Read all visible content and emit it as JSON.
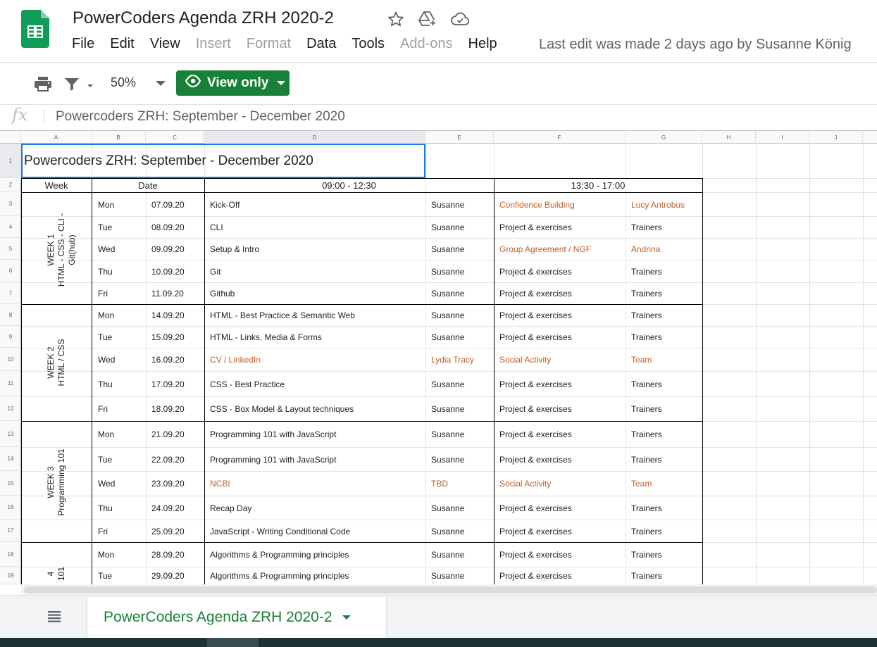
{
  "header": {
    "doc_title": "PowerCoders Agenda ZRH 2020-2",
    "last_edit": "Last edit was made 2 days ago by Susanne König",
    "menu": [
      "File",
      "Edit",
      "View",
      "Insert",
      "Format",
      "Data",
      "Tools",
      "Add-ons",
      "Help"
    ],
    "menu_disabled": [
      false,
      false,
      false,
      true,
      true,
      false,
      false,
      true,
      false
    ]
  },
  "toolbar": {
    "zoom": "50%",
    "view_only_label": "View only"
  },
  "formula_bar": {
    "fx": "fx",
    "content": "Powercoders ZRH: September - December 2020"
  },
  "grid": {
    "columns": [
      "A",
      "B",
      "C",
      "D",
      "E",
      "F",
      "G",
      "H",
      "I",
      "J"
    ],
    "rows": [
      "1",
      "2",
      "3",
      "4",
      "5",
      "6",
      "7",
      "8",
      "9",
      "10",
      "11",
      "12",
      "13",
      "14",
      "15",
      "16",
      "17",
      "18",
      "19"
    ],
    "title": "Powercoders ZRH: September - December 2020",
    "header_week": "Week",
    "header_date": "Date",
    "header_morning": "09:00 - 12:30",
    "header_afternoon": "13:30 - 17:00",
    "weeks": [
      {
        "label": "WEEK 1\nHTML - CSS - CLI -\nGit(hub)"
      },
      {
        "label": "WEEK 2\nHTML / CSS"
      },
      {
        "label": "WEEK 3\nProgramming 101"
      },
      {
        "label": "4\n101"
      }
    ],
    "days": [
      {
        "day": "Mon",
        "date": "07.09.20",
        "topic": "Kick-Off",
        "trainer": "Susanne",
        "afternoon": "Confidence Building",
        "pm_trainer": "Lucy Antrobus",
        "am_hl": false,
        "pm_hl": true
      },
      {
        "day": "Tue",
        "date": "08.09.20",
        "topic": "CLI",
        "trainer": "Susanne",
        "afternoon": "Project & exercises",
        "pm_trainer": "Trainers",
        "am_hl": false,
        "pm_hl": false
      },
      {
        "day": "Wed",
        "date": "09.09.20",
        "topic": "Setup & Intro",
        "trainer": "Susanne",
        "afternoon": "Group Agreement / NGF",
        "pm_trainer": "Andrina",
        "am_hl": false,
        "pm_hl": true
      },
      {
        "day": "Thu",
        "date": "10.09.20",
        "topic": "Git",
        "trainer": "Susanne",
        "afternoon": "Project & exercises",
        "pm_trainer": "Trainers",
        "am_hl": false,
        "pm_hl": false
      },
      {
        "day": "Fri",
        "date": "11.09.20",
        "topic": "Github",
        "trainer": "Susanne",
        "afternoon": "Project & exercises",
        "pm_trainer": "Trainers",
        "am_hl": false,
        "pm_hl": false
      },
      {
        "day": "Mon",
        "date": "14.09.20",
        "topic": "HTML - Best Practice & Semantic Web",
        "trainer": "Susanne",
        "afternoon": "Project & exercises",
        "pm_trainer": "Trainers",
        "am_hl": false,
        "pm_hl": false
      },
      {
        "day": "Tue",
        "date": "15.09.20",
        "topic": "HTML - Links, Media & Forms",
        "trainer": "Susanne",
        "afternoon": "Project & exercises",
        "pm_trainer": "Trainers",
        "am_hl": false,
        "pm_hl": false
      },
      {
        "day": "Wed",
        "date": "16.09.20",
        "topic": "CV / LinkedIn",
        "trainer": "Lydia Tracy",
        "afternoon": "Social Activity",
        "pm_trainer": "Team",
        "am_hl": true,
        "pm_hl": true
      },
      {
        "day": "Thu",
        "date": "17.09.20",
        "topic": "CSS - Best Practice",
        "trainer": "Susanne",
        "afternoon": "Project & exercises",
        "pm_trainer": "Trainers",
        "am_hl": false,
        "pm_hl": false
      },
      {
        "day": "Fri",
        "date": "18.09.20",
        "topic": "CSS - Box Model & Layout techniques",
        "trainer": "Susanne",
        "afternoon": "Project & exercises",
        "pm_trainer": "Trainers",
        "am_hl": false,
        "pm_hl": false
      },
      {
        "day": "Mon",
        "date": "21.09.20",
        "topic": "Programming 101 with JavaScript",
        "trainer": "Susanne",
        "afternoon": "Project & exercises",
        "pm_trainer": "Trainers",
        "am_hl": false,
        "pm_hl": false
      },
      {
        "day": "Tue",
        "date": "22.09.20",
        "topic": "Programming 101 with JavaScript",
        "trainer": "Susanne",
        "afternoon": "Project & exercises",
        "pm_trainer": "Trainers",
        "am_hl": false,
        "pm_hl": false
      },
      {
        "day": "Wed",
        "date": "23.09.20",
        "topic": "NCBI",
        "trainer": "TBD",
        "afternoon": "Social Activity",
        "pm_trainer": "Team",
        "am_hl": true,
        "pm_hl": true
      },
      {
        "day": "Thu",
        "date": "24.09.20",
        "topic": "Recap Day",
        "trainer": "Susanne",
        "afternoon": "Project & exercises",
        "pm_trainer": "Trainers",
        "am_hl": false,
        "pm_hl": false
      },
      {
        "day": "Fri",
        "date": "25.09.20",
        "topic": "JavaScript - Writing Conditional Code",
        "trainer": "Susanne",
        "afternoon": "Project & exercises",
        "pm_trainer": "Trainers",
        "am_hl": false,
        "pm_hl": false
      },
      {
        "day": "Mon",
        "date": "28.09.20",
        "topic": "Algorithms & Programming principles",
        "trainer": "Susanne",
        "afternoon": "Project & exercises",
        "pm_trainer": "Trainers",
        "am_hl": false,
        "pm_hl": false
      },
      {
        "day": "Tue",
        "date": "29.09.20",
        "topic": "Algorithms & Programming principles",
        "trainer": "Susanne",
        "afternoon": "Project & exercises",
        "pm_trainer": "Trainers",
        "am_hl": false,
        "pm_hl": false
      }
    ]
  },
  "bottom": {
    "sheet_tab": "PowerCoders Agenda ZRH 2020-2"
  },
  "colors": {
    "accent_green": "#188038",
    "highlight_orange": "#c0602a",
    "selection_blue": "#1a73e8"
  },
  "icons": [
    "sheets-logo-icon",
    "star-icon",
    "drive-add-icon",
    "cloud-status-icon",
    "print-icon",
    "filter-icon",
    "eye-icon",
    "sheets-list-icon"
  ]
}
